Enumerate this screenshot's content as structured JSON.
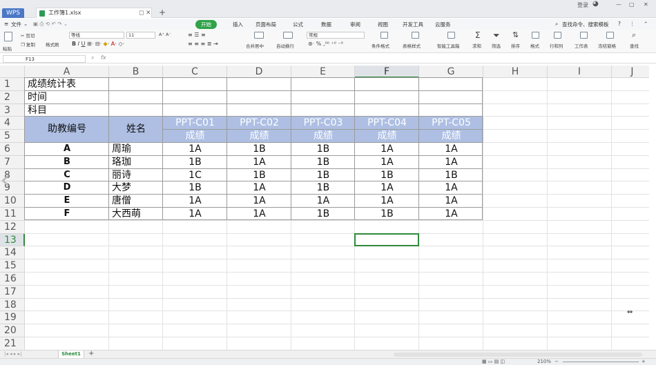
{
  "app": {
    "brand": "WPS",
    "doc_tab": "工作簿1.xlsx",
    "login": "登录"
  },
  "menu": [
    "文件",
    "开始",
    "插入",
    "页面布局",
    "公式",
    "数据",
    "审阅",
    "视图",
    "开发工具",
    "云服务"
  ],
  "menu_search": "查找命令、搜索模板",
  "ribbon": {
    "cut": "剪切",
    "copy": "复制",
    "format_painter": "格式刷",
    "paste": "粘贴",
    "font": "等线",
    "size": "11",
    "number_format": "常规",
    "merge": "合并居中",
    "wrap": "自动换行",
    "cond": "条件格式",
    "table_style": "表格样式",
    "smart": "智能工具箱",
    "sum": "求和",
    "filter": "筛选",
    "sort": "排序",
    "format": "格式",
    "rowcol": "行和列",
    "sheet": "工作表",
    "freeze": "冻结窗格",
    "find": "查找"
  },
  "formula_bar": {
    "name_box": "F13",
    "fx": "fx",
    "content": ""
  },
  "columns": [
    "A",
    "B",
    "C",
    "D",
    "E",
    "F",
    "G",
    "H",
    "I",
    "J"
  ],
  "rows": [
    "1",
    "2",
    "3",
    "4",
    "5",
    "6",
    "7",
    "8",
    "9",
    "10",
    "11",
    "12",
    "13",
    "14",
    "15",
    "16",
    "17",
    "18",
    "19",
    "20",
    "21"
  ],
  "cells": {
    "title": "成绩统计表",
    "time": "时间",
    "subject": "科目",
    "ta_header": "助教编号",
    "name_header": "姓名",
    "courses": [
      "PPT-C01",
      "PPT-C02",
      "PPT-C03",
      "PPT-C04",
      "PPT-C05"
    ],
    "score_label": "成绩",
    "students": [
      {
        "id": "A",
        "name": "周瑜",
        "scores": [
          "1A",
          "1B",
          "1B",
          "1A",
          "1A"
        ]
      },
      {
        "id": "B",
        "name": "珞珈",
        "scores": [
          "1B",
          "1A",
          "1B",
          "1A",
          "1A"
        ]
      },
      {
        "id": "C",
        "name": "丽诗",
        "scores": [
          "1C",
          "1B",
          "1B",
          "1B",
          "1B"
        ]
      },
      {
        "id": "D",
        "name": "大梦",
        "scores": [
          "1B",
          "1A",
          "1B",
          "1A",
          "1A"
        ]
      },
      {
        "id": "E",
        "name": "唐僧",
        "scores": [
          "1A",
          "1A",
          "1A",
          "1A",
          "1A"
        ]
      },
      {
        "id": "F",
        "name": "大西萌",
        "scores": [
          "1A",
          "1A",
          "1B",
          "1B",
          "1A"
        ]
      }
    ]
  },
  "active_cell": "F13",
  "sheets": [
    "Sheet1"
  ],
  "status": {
    "zoom": "210%"
  },
  "colors": {
    "header_fill": "#aebfe3",
    "accent": "#2fa24a"
  }
}
